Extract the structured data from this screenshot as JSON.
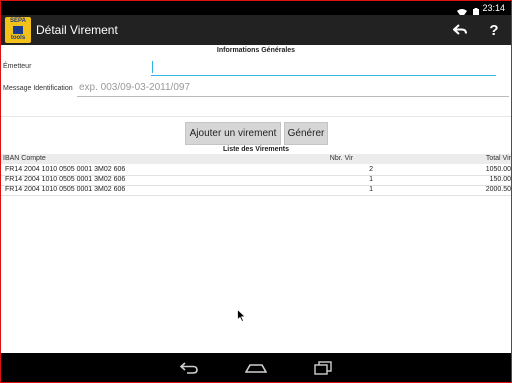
{
  "status": {
    "time": "23:14"
  },
  "app": {
    "title": "Détail Virement"
  },
  "form": {
    "section_title": "Informations Générales",
    "emetteur_label": "Émetteur",
    "emetteur_value": "",
    "message_label": "Message Identification",
    "message_placeholder": "exp. 003/09-03-2011/097"
  },
  "buttons": {
    "add": "Ajouter un virement",
    "generate": "Générer"
  },
  "list": {
    "title": "Liste des Virements",
    "columns": [
      "IBAN Compte",
      "Nbr. Vir",
      "Total Vir"
    ],
    "rows": [
      {
        "iban": "FR14 2004 1010 0505 0001 3M02 606",
        "nbr": "2",
        "total": "1050.00"
      },
      {
        "iban": "FR14 2004 1010 0505 0001 3M02 606",
        "nbr": "1",
        "total": "150.00"
      },
      {
        "iban": "FR14 2004 1010 0505 0001 3M02 606",
        "nbr": "1",
        "total": "2000.50"
      }
    ]
  },
  "logo": {
    "line1": "SEPA",
    "line2": "tools"
  },
  "colors": {
    "accent": "#33b5e5",
    "actionbar": "#222222",
    "frame": "#e01010"
  }
}
